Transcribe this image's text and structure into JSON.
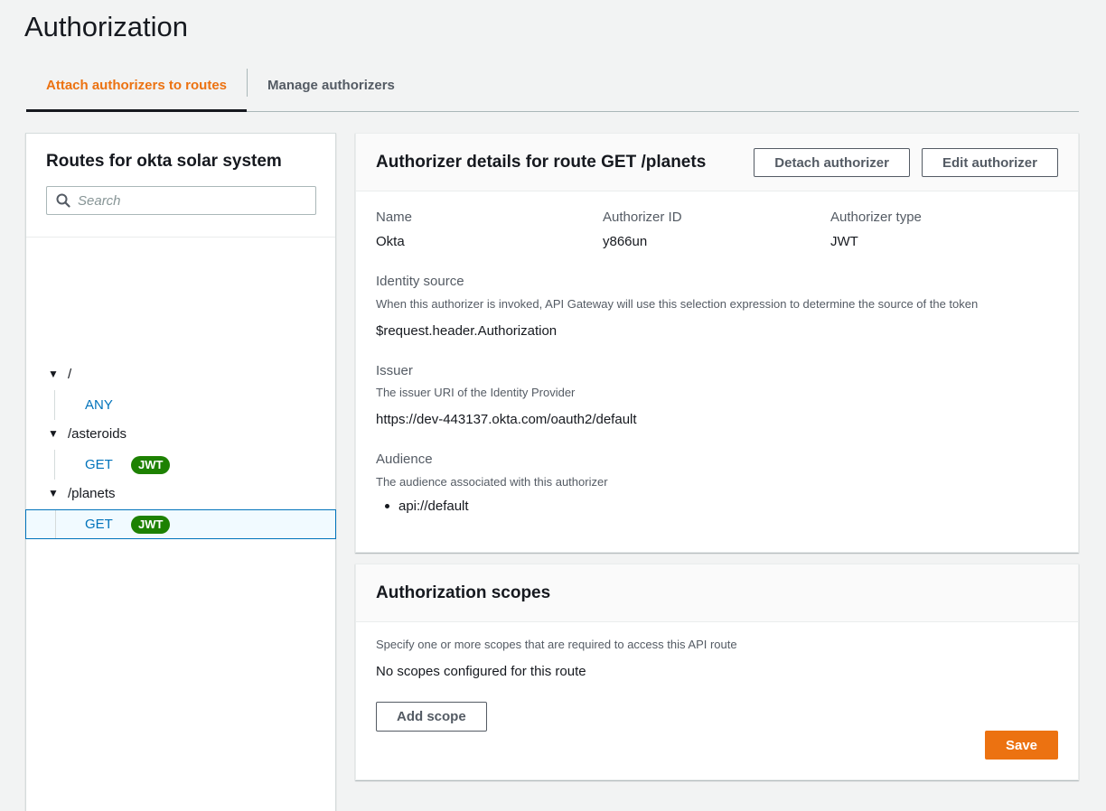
{
  "page": {
    "title": "Authorization"
  },
  "tabs": [
    {
      "label": "Attach authorizers to routes",
      "active": true
    },
    {
      "label": "Manage authorizers",
      "active": false
    }
  ],
  "routes": {
    "title": "Routes for okta solar system",
    "search_placeholder": "Search",
    "tree": [
      {
        "path": "/",
        "methods": [
          {
            "method": "ANY",
            "badge": ""
          }
        ]
      },
      {
        "path": "/asteroids",
        "methods": [
          {
            "method": "GET",
            "badge": "JWT"
          }
        ]
      },
      {
        "path": "/planets",
        "methods": [
          {
            "method": "GET",
            "badge": "JWT",
            "selected": true
          }
        ]
      }
    ]
  },
  "details": {
    "title": "Authorizer details for route GET /planets",
    "detach_label": "Detach authorizer",
    "edit_label": "Edit authorizer",
    "name_label": "Name",
    "name_value": "Okta",
    "id_label": "Authorizer ID",
    "id_value": "y866un",
    "type_label": "Authorizer type",
    "type_value": "JWT",
    "identity_label": "Identity source",
    "identity_desc": "When this authorizer is invoked, API Gateway will use this selection expression to determine the source of the token",
    "identity_value": "$request.header.Authorization",
    "issuer_label": "Issuer",
    "issuer_desc": "The issuer URI of the Identity Provider",
    "issuer_value": "https://dev-443137.okta.com/oauth2/default",
    "audience_label": "Audience",
    "audience_desc": "The audience associated with this authorizer",
    "audience_values": [
      "api://default"
    ]
  },
  "scopes": {
    "title": "Authorization scopes",
    "desc": "Specify one or more scopes that are required to access this API route",
    "empty_text": "No scopes configured for this route",
    "add_label": "Add scope",
    "save_label": "Save"
  },
  "colors": {
    "accent": "#ec7211",
    "link": "#0073bb",
    "badge": "#1d8102"
  }
}
